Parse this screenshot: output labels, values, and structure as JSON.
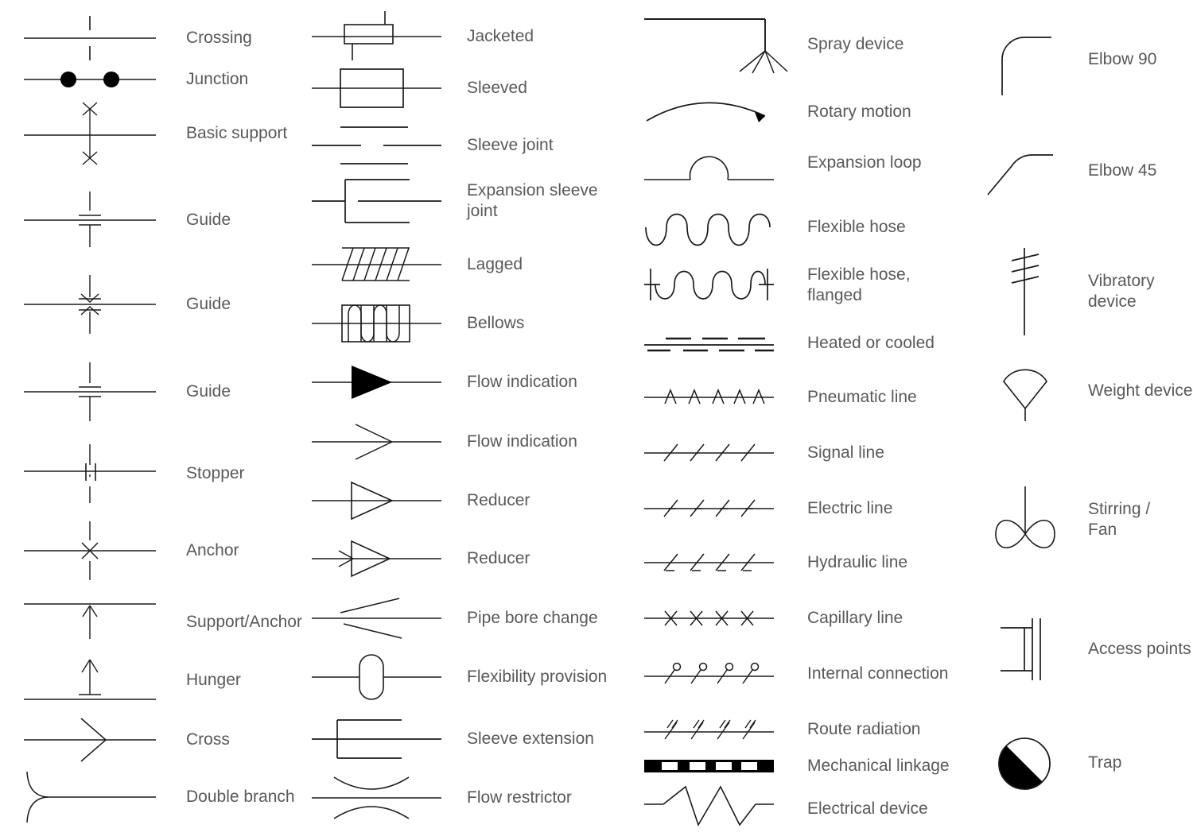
{
  "diagram": {
    "type": "piping-symbols-legend",
    "stroke_color": "#1a1a1a",
    "label_color": "#58595b",
    "background": "#ffffff",
    "columns": [
      {
        "id": "column-1",
        "items": [
          {
            "label": "Crossing",
            "icon": "crossing-symbol"
          },
          {
            "label": "Junction",
            "icon": "junction-symbol"
          },
          {
            "label": "Basic support",
            "icon": "basic-support-symbol"
          },
          {
            "label": "Guide",
            "icon": "guide-1-symbol"
          },
          {
            "label": "Guide",
            "icon": "guide-2-symbol"
          },
          {
            "label": "Guide",
            "icon": "guide-3-symbol"
          },
          {
            "label": "Stopper",
            "icon": "stopper-symbol"
          },
          {
            "label": "Anchor",
            "icon": "anchor-symbol"
          },
          {
            "label": "Support/Anchor",
            "icon": "support-anchor-symbol"
          },
          {
            "label": "Hunger",
            "icon": "hunger-symbol"
          },
          {
            "label": "Cross",
            "icon": "cross-symbol"
          },
          {
            "label": "Double branch",
            "icon": "double-branch-symbol"
          }
        ]
      },
      {
        "id": "column-2",
        "items": [
          {
            "label": "Jacketed",
            "icon": "jacketed-symbol"
          },
          {
            "label": "Sleeved",
            "icon": "sleeved-symbol"
          },
          {
            "label": "Sleeve joint",
            "icon": "sleeve-joint-symbol"
          },
          {
            "label": "Expansion sleeve\njoint",
            "icon": "expansion-sleeve-joint-symbol"
          },
          {
            "label": "Lagged",
            "icon": "lagged-symbol"
          },
          {
            "label": "Bellows",
            "icon": "bellows-symbol"
          },
          {
            "label": "Flow indication",
            "icon": "flow-indication-filled-symbol"
          },
          {
            "label": "Flow indication",
            "icon": "flow-indication-open-symbol"
          },
          {
            "label": "Reducer",
            "icon": "reducer-symbol"
          },
          {
            "label": "Reducer",
            "icon": "reducer-arrow-symbol"
          },
          {
            "label": "Pipe bore change",
            "icon": "pipe-bore-change-symbol"
          },
          {
            "label": "Flexibility provision",
            "icon": "flexibility-provision-symbol"
          },
          {
            "label": "Sleeve extension",
            "icon": "sleeve-extension-symbol"
          },
          {
            "label": "Flow restrictor",
            "icon": "flow-restrictor-symbol"
          }
        ]
      },
      {
        "id": "column-3",
        "items": [
          {
            "label": "Spray device",
            "icon": "spray-device-symbol"
          },
          {
            "label": "Rotary motion",
            "icon": "rotary-motion-symbol"
          },
          {
            "label": "Expansion loop",
            "icon": "expansion-loop-symbol"
          },
          {
            "label": "Flexible hose",
            "icon": "flexible-hose-symbol"
          },
          {
            "label": "Flexible hose,\nflanged",
            "icon": "flexible-hose-flanged-symbol"
          },
          {
            "label": "Heated or cooled",
            "icon": "heated-or-cooled-symbol"
          },
          {
            "label": "Pneumatic line",
            "icon": "pneumatic-line-symbol"
          },
          {
            "label": "Signal line",
            "icon": "signal-line-symbol"
          },
          {
            "label": "Electric line",
            "icon": "electric-line-symbol"
          },
          {
            "label": "Hydraulic line",
            "icon": "hydraulic-line-symbol"
          },
          {
            "label": "Capillary line",
            "icon": "capillary-line-symbol"
          },
          {
            "label": "Internal connection",
            "icon": "internal-connection-symbol"
          },
          {
            "label": "Route radiation",
            "icon": "route-radiation-symbol"
          },
          {
            "label": "Mechanical linkage",
            "icon": "mechanical-linkage-symbol"
          },
          {
            "label": "Electrical device",
            "icon": "electrical-device-symbol"
          }
        ]
      },
      {
        "id": "column-4",
        "items": [
          {
            "label": "Elbow 90",
            "icon": "elbow-90-symbol"
          },
          {
            "label": "Elbow 45",
            "icon": "elbow-45-symbol"
          },
          {
            "label": "Vibratory device",
            "icon": "vibratory-device-symbol"
          },
          {
            "label": "Weight device",
            "icon": "weight-device-symbol"
          },
          {
            "label": "Stirring /\nFan",
            "icon": "stirring-fan-symbol"
          },
          {
            "label": "Access points",
            "icon": "access-points-symbol"
          },
          {
            "label": "Trap",
            "icon": "trap-symbol"
          }
        ]
      }
    ]
  }
}
